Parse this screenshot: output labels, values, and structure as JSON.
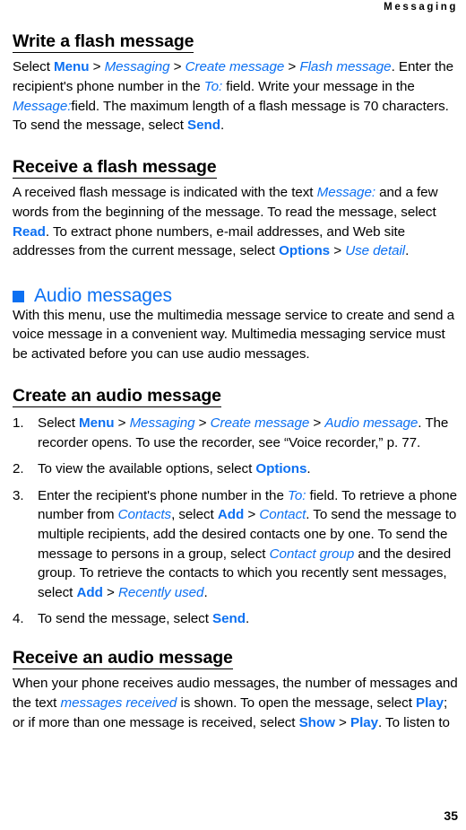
{
  "page": {
    "running_header": "Messaging",
    "folio": "35",
    "accent_color": "#0c70f2",
    "text_color": "#000000",
    "background_color": "#ffffff"
  },
  "sections": {
    "write_flash": {
      "heading": "Write a flash message",
      "paragraph": {
        "p1": "Select ",
        "menu": "Menu",
        "sep1": " > ",
        "messaging": "Messaging",
        "sep2": " > ",
        "create_message": "Create message",
        "sep3": " > ",
        "flash_message": "Flash message",
        "p2": ". Enter the recipient's phone number in the ",
        "to_field": "To:",
        "p3": " field. Write your message in the ",
        "message_field": "Message:",
        "p4": "field. The maximum length of a flash message is 70 characters. To send the message, select ",
        "send": "Send",
        "p5": "."
      }
    },
    "receive_flash": {
      "heading": "Receive a flash message",
      "paragraph": {
        "p1": "A received flash message is indicated with the text ",
        "message_field": "Message:",
        "p2": " and a few words from the beginning of the message. To read the message, select ",
        "read": "Read",
        "p3": ". To extract phone numbers, e-mail addresses, and Web site addresses from the current message, select ",
        "options": "Options",
        "sep1": " > ",
        "use_detail": "Use detail",
        "p4": "."
      }
    },
    "audio_messages": {
      "bullet_icon": "blue-square-bullet",
      "heading": "Audio messages",
      "paragraph": "With this menu, use the multimedia message service to create and send a voice message in a convenient way. Multimedia messaging service must be activated before you can use audio messages."
    },
    "create_audio": {
      "heading": "Create an audio message",
      "steps": [
        {
          "number": "1.",
          "p1": "Select ",
          "menu": "Menu",
          "sep1": " > ",
          "messaging": "Messaging",
          "sep2": " > ",
          "create_message": "Create message",
          "sep3": " > ",
          "audio_message": "Audio message",
          "p2": ". The recorder opens. To use the recorder, see “Voice recorder,” p. 77."
        },
        {
          "number": "2.",
          "p1": "To view the available options, select ",
          "options": "Options",
          "p2": "."
        },
        {
          "number": "3.",
          "p1": "Enter the recipient's phone number in the ",
          "to_field": "To:",
          "p2": " field. To retrieve a phone number from ",
          "contacts": "Contacts",
          "p3": ", select ",
          "add": "Add",
          "sep1": " > ",
          "contact": "Contact",
          "p4": ". To send the message to multiple recipients, add the desired contacts one by one. To send the message to persons in a group, select ",
          "contact_group": "Contact group",
          "p5": " and the desired group. To retrieve the contacts to which you recently sent messages, select ",
          "add2": "Add",
          "sep2": " > ",
          "recently_used": "Recently used",
          "p6": "."
        },
        {
          "number": "4.",
          "p1": "To send the message, select ",
          "send": "Send",
          "p2": "."
        }
      ]
    },
    "receive_audio": {
      "heading": "Receive an audio message",
      "paragraph": {
        "p1": "When your phone receives audio messages, the number of messages and the text ",
        "messages_received": "messages received",
        "p2": " is shown. To open the message, select ",
        "play": "Play",
        "p3": "; or if more than one message is received, select ",
        "show": "Show",
        "sep1": " > ",
        "play2": "Play",
        "p4": ". To listen to"
      }
    }
  }
}
